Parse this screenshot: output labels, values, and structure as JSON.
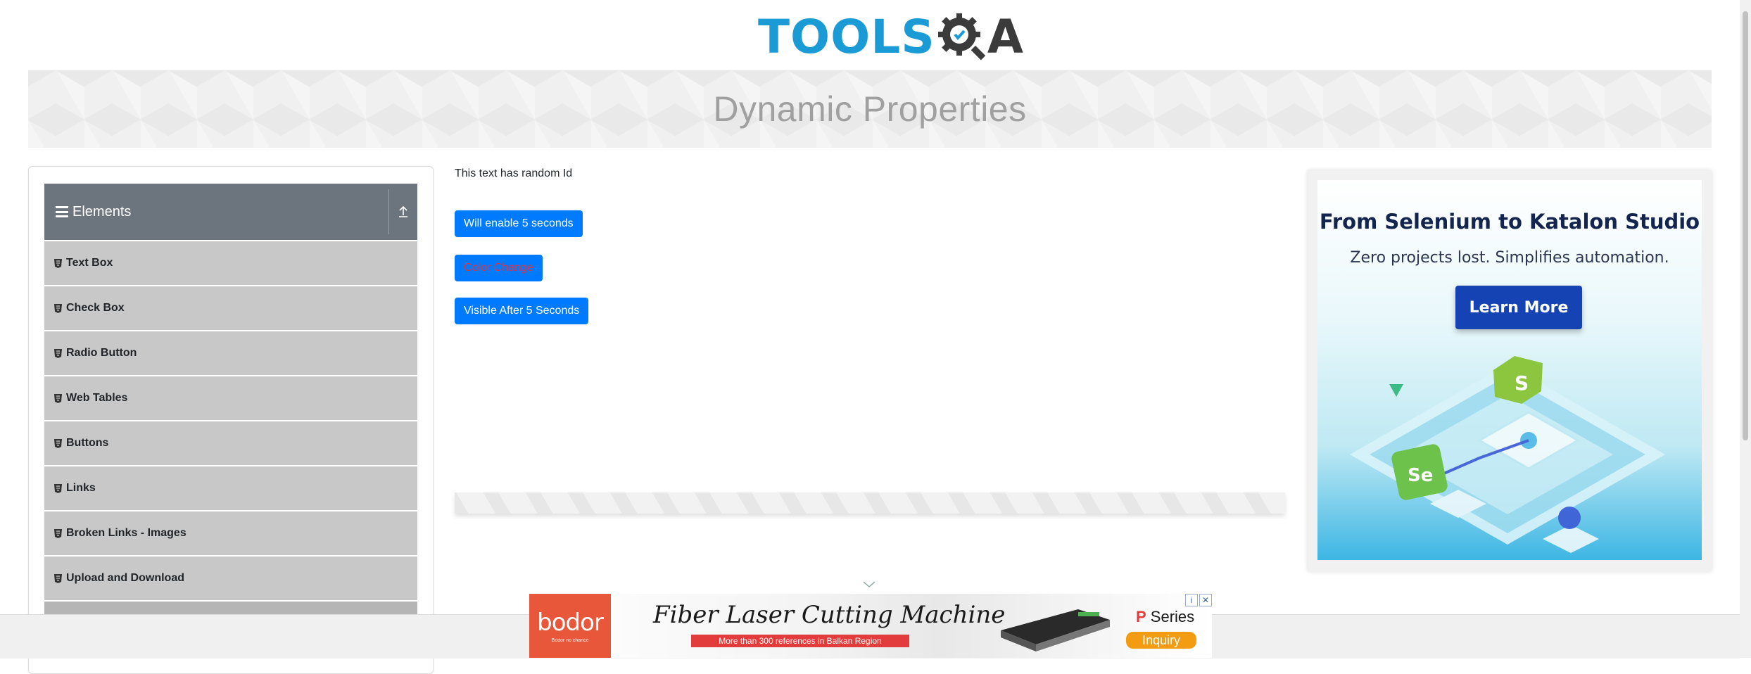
{
  "header": {
    "logo_tools": "TOOLS",
    "logo_a": "A"
  },
  "banner": {
    "title": "Dynamic Properties"
  },
  "sidebar": {
    "group_title": "Elements",
    "items": [
      {
        "label": "Text Box"
      },
      {
        "label": "Check Box"
      },
      {
        "label": "Radio Button"
      },
      {
        "label": "Web Tables"
      },
      {
        "label": "Buttons"
      },
      {
        "label": "Links"
      },
      {
        "label": "Broken Links - Images"
      },
      {
        "label": "Upload and Download"
      }
    ]
  },
  "main": {
    "random_text": "This text has random Id",
    "buttons": {
      "enable": "Will enable 5 seconds",
      "color": "Color Change",
      "visible": "Visible After 5 Seconds"
    }
  },
  "side_ad": {
    "headline": "From Selenium to Katalon Studio",
    "sub": "Zero projects lost. Simplifies automation.",
    "cta": "Learn More"
  },
  "bottom_ad": {
    "brand": "bodor",
    "brand_tag": "Bodor no chance",
    "title": "Fiber Laser Cutting Machine",
    "sub": "More than 300 references in Balkan Region",
    "series_p": "P",
    "series_rest": " Series",
    "inquiry": "Inquiry"
  },
  "colors": {
    "primary": "#007bff",
    "danger_text": "#dc3545",
    "sidebar_header": "#6c757d",
    "menu_item_bg": "#c8c8c8",
    "logo_blue": "#1b9bd6"
  },
  "icons": {
    "menu": "hamburger-icon",
    "collapse": "upload-arrow-icon",
    "item": "html5-shield-icon"
  }
}
